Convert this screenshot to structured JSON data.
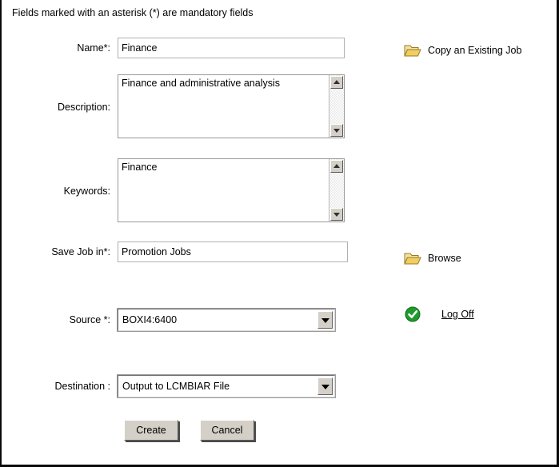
{
  "form": {
    "note": "Fields marked with an asterisk (*) are mandatory fields",
    "fields": [
      {
        "label": "Name*:",
        "value": "Finance",
        "type": "text"
      },
      {
        "label": "Description:",
        "value": "Finance and administrative analysis",
        "type": "textarea"
      },
      {
        "label": "Keywords:",
        "value": "Finance",
        "type": "textarea"
      },
      {
        "label": "Save Job in*:",
        "value": "Promotion Jobs",
        "type": "text"
      },
      {
        "label": "Source *:",
        "value": "BOXI4:6400",
        "type": "select"
      },
      {
        "label": "Destination :",
        "value": "Output to LCMBIAR File",
        "type": "select"
      }
    ]
  },
  "actions": [
    {
      "label": "Copy an Existing Job",
      "icon": "folder-icon",
      "underline": false
    },
    {
      "label": "Browse",
      "icon": "folder-icon",
      "underline": false
    },
    {
      "label": "Log Off",
      "icon": "green-check-icon",
      "underline": true
    }
  ],
  "buttons": {
    "create": "Create",
    "cancel": "Cancel"
  },
  "colors": {
    "folder_icon": "#E8C25A",
    "check_icon": "#199B26",
    "button_face": "#D4D0C8",
    "border": "#0A0A0A"
  }
}
